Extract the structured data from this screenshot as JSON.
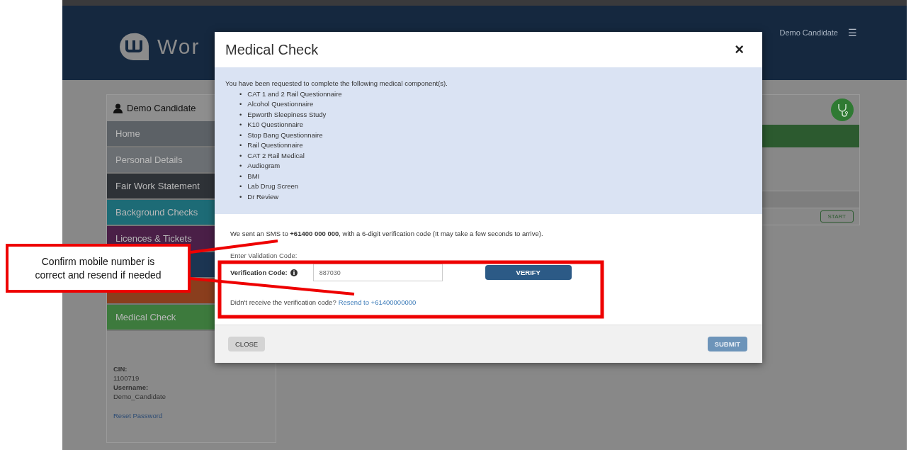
{
  "header": {
    "logo_text": "Wor",
    "user_name": "Demo Candidate",
    "menu_icon": "☰"
  },
  "sidebar": {
    "user_name": "Demo Candidate",
    "items": [
      {
        "label": "Home",
        "color": "#5c6166"
      },
      {
        "label": "Personal Details",
        "color": "#6b6f73"
      },
      {
        "label": "Fair Work Statement",
        "color": "#2e3237"
      },
      {
        "label": "Background Checks",
        "color": "#1d6b76"
      },
      {
        "label": "Licences & Tickets",
        "color": "#4a1f47"
      },
      {
        "color": "#1c3552"
      },
      {
        "color": "#8a3e1d"
      },
      {
        "label": "Medical Check",
        "color": "#3d7a3d"
      }
    ],
    "details": [
      {
        "kind": "label",
        "text": "CIN:"
      },
      {
        "kind": "value",
        "text": "1100719"
      },
      {
        "kind": "label",
        "text": "Username:"
      },
      {
        "kind": "value",
        "text": "Demo_Candidate"
      }
    ],
    "reset_link": "Reset Password"
  },
  "main": {
    "start_button": "START"
  },
  "modal": {
    "title": "Medical Check",
    "close_icon": "×",
    "intro": "You have been requested to complete the following medical component(s).",
    "bullet": "•",
    "components": [
      "CAT 1 and 2 Rail Questionnaire",
      "Alcohol Questionnaire",
      "Epworth Sleepiness Study",
      "K10 Questionnaire",
      "Stop Bang Questionnaire",
      "Rail Questionnaire",
      "CAT 2 Rail Medical",
      "Audiogram",
      "BMI",
      "Lab Drug Screen",
      "Dr Review"
    ],
    "sms_text": "We sent an SMS to **+61400 000 000**, with a 6-digit verification code (It may take a few seconds to arrive).",
    "enter_label": "Enter Validation Code:",
    "code_label": "Verification Code:",
    "code_value": "887030",
    "verify_button": "VERIFY",
    "resend_prompt": "Didn't receive the verification code?",
    "resend_link": "Resend to +61400000000",
    "close_button": "CLOSE",
    "submit_button": "SUBMIT"
  },
  "annotation": {
    "text": "Confirm mobile number is correct and resend if needed"
  }
}
